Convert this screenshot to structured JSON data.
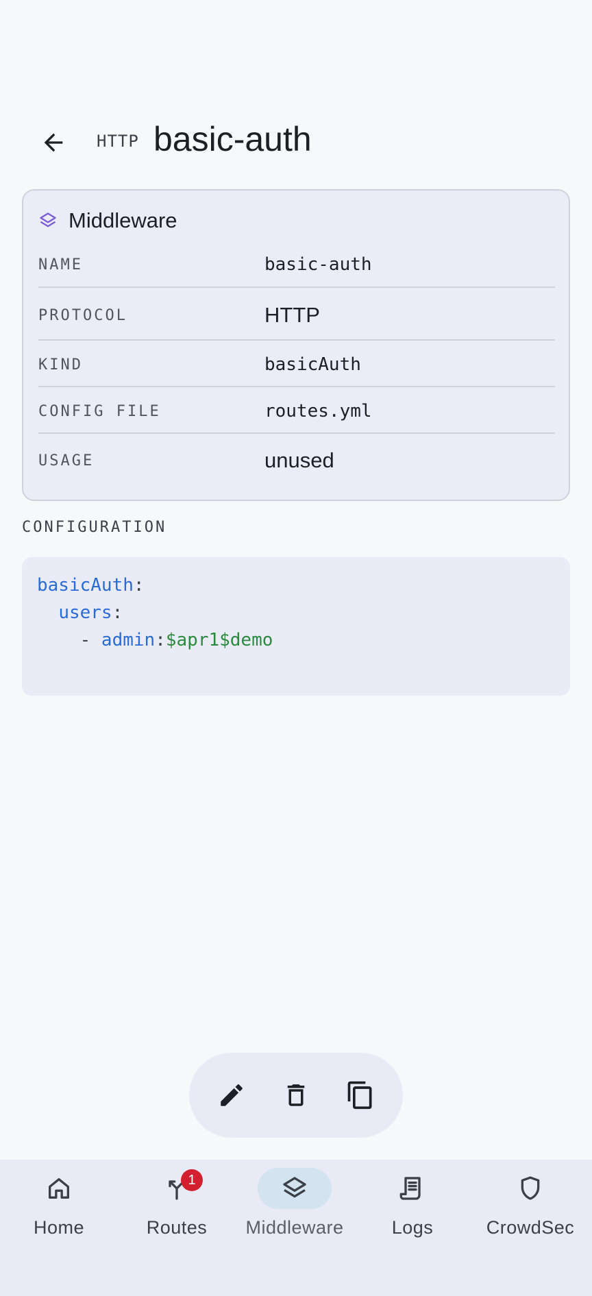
{
  "header": {
    "protocol": "HTTP",
    "title": "basic-auth"
  },
  "card": {
    "title": "Middleware",
    "rows": [
      {
        "key": "NAME",
        "value": "basic-auth"
      },
      {
        "key": "PROTOCOL",
        "value": "HTTP"
      },
      {
        "key": "KIND",
        "value": "basicAuth"
      },
      {
        "key": "CONFIG FILE",
        "value": "routes.yml"
      },
      {
        "key": "USAGE",
        "value": "unused"
      }
    ]
  },
  "configuration": {
    "label": "CONFIGURATION",
    "lines": [
      {
        "indent": "",
        "key": "basicAuth",
        "sep": ":",
        "value": ""
      },
      {
        "indent": "  ",
        "key": "users",
        "sep": ":",
        "value": ""
      },
      {
        "indent": "    - ",
        "key": "admin",
        "sep": ":",
        "value": "$apr1$demo"
      }
    ]
  },
  "bottom_nav": {
    "items": [
      {
        "label": "Home",
        "icon": "home-icon"
      },
      {
        "label": "Routes",
        "icon": "routes-icon",
        "badge": "1"
      },
      {
        "label": "Middleware",
        "icon": "layers-icon",
        "active": true
      },
      {
        "label": "Logs",
        "icon": "logs-icon"
      },
      {
        "label": "CrowdSec",
        "icon": "shield-icon"
      }
    ]
  },
  "colors": {
    "accent": "#7b5cd6",
    "key": "#2a6bd6",
    "string": "#2b8a3e",
    "badge": "#d32030",
    "active_pill": "#d3e3f0"
  }
}
